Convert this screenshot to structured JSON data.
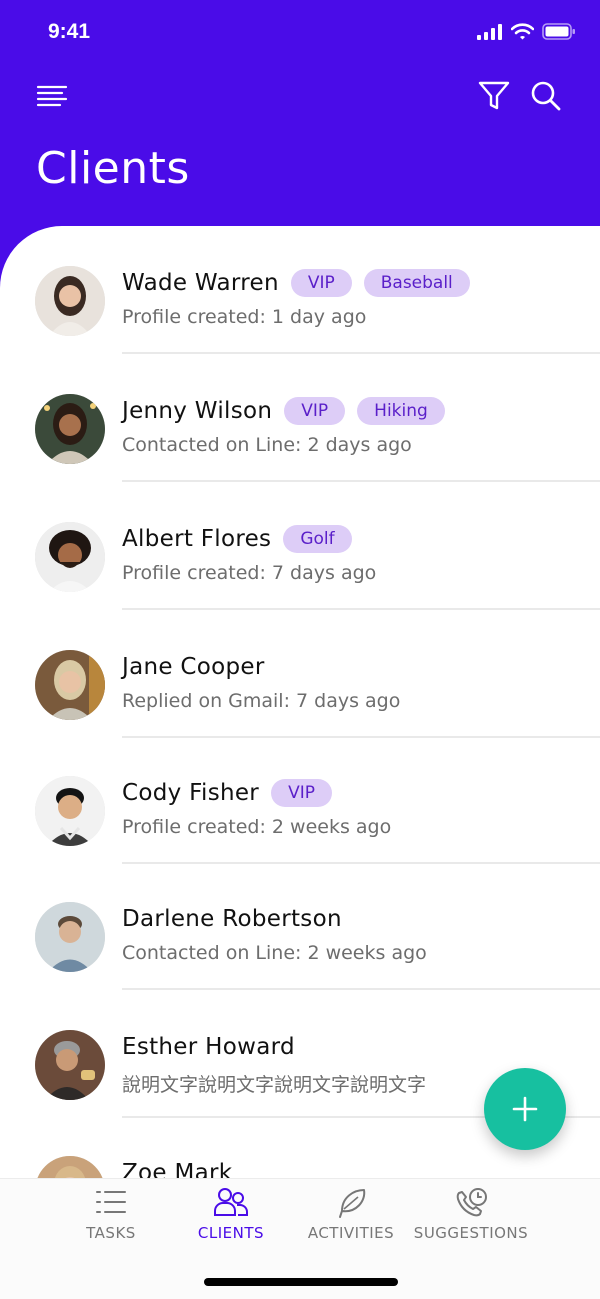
{
  "status_bar": {
    "time": "9:41"
  },
  "header": {
    "title": "Clients"
  },
  "colors": {
    "brand": "#4a0ce8",
    "tag_bg": "#ddcdf7",
    "tag_text": "#5a1fc9",
    "fab": "#17c0a0"
  },
  "icons": {
    "menu": "menu-icon",
    "filter": "filter-icon",
    "search": "search-icon",
    "add": "plus-icon"
  },
  "clients": [
    {
      "name": "Wade Warren",
      "tags": [
        "VIP",
        "Baseball"
      ],
      "subtitle": "Profile created: 1 day ago"
    },
    {
      "name": "Jenny Wilson",
      "tags": [
        "VIP",
        "Hiking"
      ],
      "subtitle": "Contacted on Line: 2 days ago"
    },
    {
      "name": "Albert Flores",
      "tags": [
        "Golf"
      ],
      "subtitle": "Profile created: 7 days ago"
    },
    {
      "name": "Jane Cooper",
      "tags": [],
      "subtitle": "Replied on Gmail: 7 days ago"
    },
    {
      "name": "Cody Fisher",
      "tags": [
        "VIP"
      ],
      "subtitle": "Profile created: 2 weeks ago"
    },
    {
      "name": "Darlene Robertson",
      "tags": [],
      "subtitle": "Contacted on Line: 2 weeks ago"
    },
    {
      "name": "Esther Howard",
      "tags": [],
      "subtitle": "說明文字說明文字說明文字說明文字"
    },
    {
      "name": "Zoe Mark",
      "tags": [],
      "subtitle": ""
    }
  ],
  "bottom_nav": [
    {
      "label": "TASKS",
      "icon": "list-icon",
      "active": false
    },
    {
      "label": "CLIENTS",
      "icon": "people-icon",
      "active": true
    },
    {
      "label": "ACTIVITIES",
      "icon": "feather-icon",
      "active": false
    },
    {
      "label": "SUGGESTIONS",
      "icon": "phone-clock-icon",
      "active": false
    }
  ]
}
